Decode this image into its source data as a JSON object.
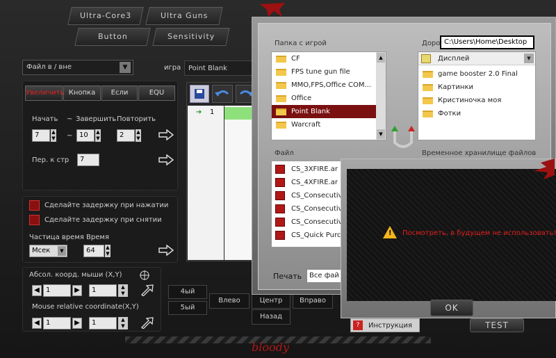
{
  "top_tabs": [
    "Ultra-Core3",
    "Ultra Guns",
    "Button",
    "Sensitivity"
  ],
  "file_scope": {
    "value": "Файл в / вне"
  },
  "game": {
    "label": "игра",
    "value": "Point Blank"
  },
  "mode_tabs": [
    "Увеличить",
    "Кнопка",
    "Если",
    "EQU"
  ],
  "repeat": {
    "start_label": "Начать",
    "tilde1": "~",
    "end_label": "Завершить",
    "repeat_label": "Повторить",
    "start": "7",
    "tilde2": "~",
    "end": "10",
    "count": "2",
    "per_label": "Пер. к стр",
    "per": "7"
  },
  "delay": {
    "press_label": "Сделайте задержку при нажатии",
    "release_label": "Сделайте задержку при снятии",
    "freq_label": "Частица время Время",
    "unit": "Мсек",
    "value": "64"
  },
  "mouse": {
    "abs_label": "Абсол. коорд. мыши (X,Y)",
    "abs_x": "1",
    "abs_y": "1",
    "rel_label": "Mouse relative coordinate(X,Y)",
    "rel_x": "1",
    "rel_y": "1"
  },
  "keys": {
    "k4": "4ый",
    "k5": "5ый",
    "left": "Влево",
    "center": "Центр",
    "right": "Вправо",
    "back": "Назад"
  },
  "script": {
    "line": "1"
  },
  "folder_dialog": {
    "games_title": "Папка с игрой",
    "games": [
      "CF",
      "FPS tune gun file",
      "MMO,FPS,Office COM...",
      "Office",
      "Point Blank",
      "Warcraft"
    ],
    "path_title": "Доро",
    "path_value": "C:\\Users\\Home\\Desktop",
    "drive": "Дисплей",
    "path_items": [
      "game booster 2.0 Final",
      "Картинки",
      "Кристиночка моя",
      "Фотки"
    ],
    "file_title": "Файл",
    "files": [
      "CS_3XFIRE.ar",
      "CS_4XFIRE.ar",
      "CS_Consecutive",
      "CS_Consecutive",
      "CS_Consecutive",
      "CS_Quick Purch"
    ],
    "temp_title": "Временное хранилище файлов",
    "print_label": "Печать",
    "print_value": "Все фай"
  },
  "alert": {
    "message": "Посмотреть, в будущем не использовать!",
    "ok": "OK",
    "test": "TEST"
  },
  "instruction_label": "Инструкция",
  "brand": "bloody",
  "colors": {
    "accent_red": "#e02020",
    "highlight_green": "#8ee07a",
    "selected_row": "#7a1010"
  }
}
